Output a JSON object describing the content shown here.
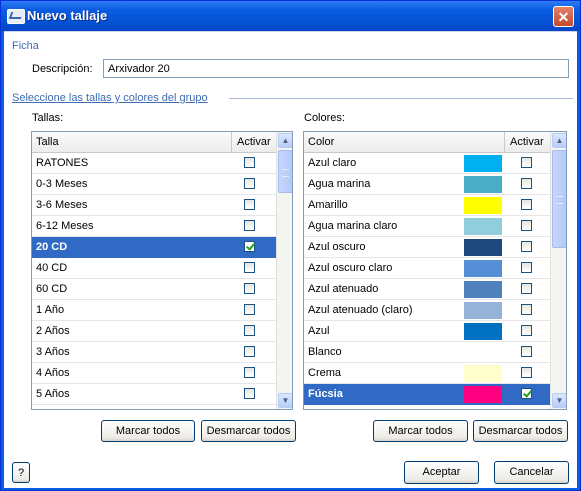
{
  "window": {
    "title": "Nuevo tallaje",
    "close_glyph": "✕"
  },
  "ficha": {
    "section_label": "Ficha",
    "description_label": "Descripción:",
    "description_value": "Arxivador 20"
  },
  "group": {
    "section_label": "Seleccione las tallas y colores del grupo"
  },
  "tallas": {
    "label": "Tallas:",
    "columns": [
      "Talla",
      "Activar"
    ],
    "rows": [
      {
        "name": "RATONES",
        "checked": false,
        "selected": false
      },
      {
        "name": "0-3 Meses",
        "checked": false,
        "selected": false
      },
      {
        "name": "3-6 Meses",
        "checked": false,
        "selected": false
      },
      {
        "name": "6-12 Meses",
        "checked": false,
        "selected": false
      },
      {
        "name": "20 CD",
        "checked": true,
        "selected": true
      },
      {
        "name": "40 CD",
        "checked": false,
        "selected": false
      },
      {
        "name": "60 CD",
        "checked": false,
        "selected": false
      },
      {
        "name": "1 Año",
        "checked": false,
        "selected": false
      },
      {
        "name": "2 Años",
        "checked": false,
        "selected": false
      },
      {
        "name": "3 Años",
        "checked": false,
        "selected": false
      },
      {
        "name": "4 Años",
        "checked": false,
        "selected": false
      },
      {
        "name": "5 Años",
        "checked": false,
        "selected": false
      }
    ],
    "mark_all": "Marcar todos",
    "unmark_all": "Desmarcar todos"
  },
  "colores": {
    "label": "Colores:",
    "columns": [
      "Color",
      "Activar"
    ],
    "rows": [
      {
        "name": "Azul claro",
        "color": "#00b0f0",
        "checked": false,
        "selected": false
      },
      {
        "name": "Agua marina",
        "color": "#4bacc6",
        "checked": false,
        "selected": false
      },
      {
        "name": "Amarillo",
        "color": "#ffff00",
        "checked": false,
        "selected": false
      },
      {
        "name": "Agua marina claro",
        "color": "#92cddc",
        "checked": false,
        "selected": false
      },
      {
        "name": "Azul oscuro",
        "color": "#1f497d",
        "checked": false,
        "selected": false
      },
      {
        "name": "Azul oscuro claro",
        "color": "#558ed5",
        "checked": false,
        "selected": false
      },
      {
        "name": "Azul atenuado",
        "color": "#4f81bd",
        "checked": false,
        "selected": false
      },
      {
        "name": "Azul atenuado (claro)",
        "color": "#95b3d7",
        "checked": false,
        "selected": false
      },
      {
        "name": "Azul",
        "color": "#0070c0",
        "checked": false,
        "selected": false
      },
      {
        "name": "Blanco",
        "color": "#ffffff",
        "checked": false,
        "selected": false
      },
      {
        "name": "Crema",
        "color": "#ffffcc",
        "checked": false,
        "selected": false
      },
      {
        "name": "Fúcsia",
        "color": "#ff0080",
        "checked": true,
        "selected": true
      }
    ],
    "mark_all": "Marcar todos",
    "unmark_all": "Desmarcar todos"
  },
  "footer": {
    "help": "?",
    "accept": "Aceptar",
    "cancel": "Cancelar"
  },
  "scroll_glyphs": {
    "up": "▲",
    "down": "▼"
  },
  "accent_colors": {
    "titlebar": "#0a5ce0",
    "selection": "#316ac5",
    "section_text": "#3d6cb3"
  }
}
